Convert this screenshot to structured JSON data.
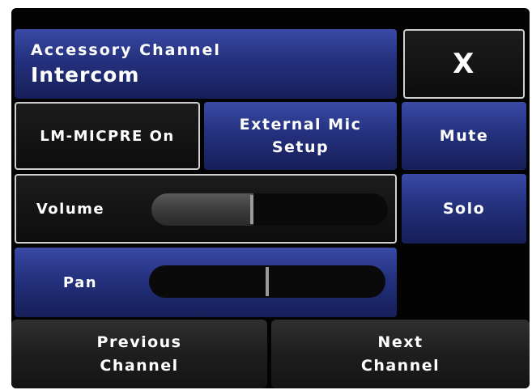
{
  "header": {
    "label": "Accessory Channel",
    "value": "Intercom",
    "close_label": "X"
  },
  "row1": {
    "micpre_label": "LM-MICPRE On",
    "external_mic_label": "External Mic\nSetup",
    "mute_label": "Mute"
  },
  "volume": {
    "label": "Volume",
    "level": 0.43
  },
  "solo_label": "Solo",
  "pan": {
    "label": "Pan",
    "position": 0.5
  },
  "footer": {
    "previous_label": "Previous\nChannel",
    "next_label": "Next\nChannel"
  },
  "colors": {
    "accent_blue": "#24317e",
    "background": "#030303",
    "border": "#cfcfcf"
  }
}
